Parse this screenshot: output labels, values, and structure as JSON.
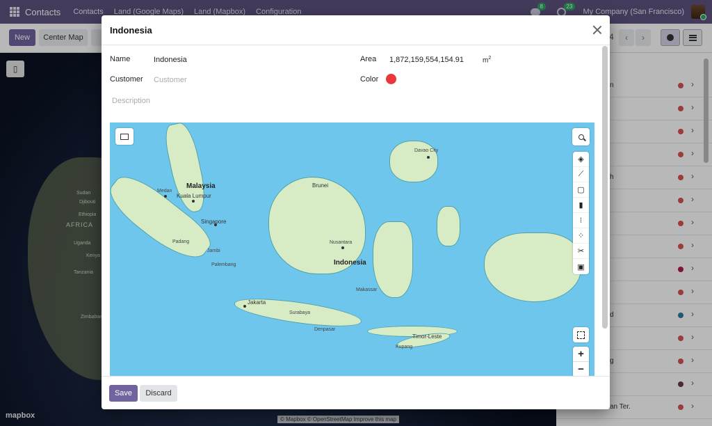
{
  "navbar": {
    "brand": "Contacts",
    "menu": [
      "Contacts",
      "Land (Google Maps)",
      "Land (Mapbox)",
      "Configuration"
    ],
    "messages_count": "8",
    "activities_count": "23",
    "company": "My Company (San Francisco)"
  },
  "control_panel": {
    "new_label": "New",
    "center_map_label": "Center Map",
    "pager": "4",
    "prev": "‹",
    "next": "›"
  },
  "background_map": {
    "labels": [
      "Sudan",
      "Djibouti",
      "Ethiopia",
      "AFRICA",
      "Uganda",
      "Kenya",
      "Tanzania",
      "Zimbabwe"
    ],
    "logo": "mapbox",
    "attribution": "© Mapbox © OpenStreetMap  Improve this map"
  },
  "list": {
    "rows": [
      {
        "text": "n",
        "color": "#d9534f"
      },
      {
        "text": "",
        "color": "#d9534f"
      },
      {
        "text": "",
        "color": "#d9534f"
      },
      {
        "text": "",
        "color": "#d9534f"
      },
      {
        "text": "h",
        "color": "#d9534f"
      },
      {
        "text": "",
        "color": "#d9534f"
      },
      {
        "text": "",
        "color": "#d9534f"
      },
      {
        "text": "",
        "color": "#d9534f"
      },
      {
        "text": "",
        "color": "#b01e4a"
      },
      {
        "text": "",
        "color": "#d9534f"
      },
      {
        "text": "d",
        "color": "#2a7ea0"
      },
      {
        "text": "",
        "color": "#d9534f"
      },
      {
        "text": "g",
        "color": "#d9534f"
      },
      {
        "text": "",
        "color": "#6b3a4e"
      },
      {
        "text": "an Ter.",
        "color": "#d9534f"
      }
    ],
    "chevron": "›"
  },
  "modal": {
    "title": "Indonesia",
    "name_label": "Name",
    "name_value": "Indonesia",
    "customer_label": "Customer",
    "customer_placeholder": "Customer",
    "description_placeholder": "Description",
    "area_label": "Area",
    "area_value": "1,872,159,554,154.91",
    "area_unit": "m",
    "area_unit_exp": "2",
    "color_label": "Color",
    "color_value": "#e8383d",
    "save_label": "Save",
    "discard_label": "Discard"
  },
  "map": {
    "labels": {
      "malaysia": "Malaysia",
      "brunei": "Brunei",
      "indonesia": "Indonesia",
      "medan": "Medan",
      "kuala_lumpur": "Kuala Lumpur",
      "singapore": "Singapore",
      "padang": "Padang",
      "jambi": "Jambi",
      "palembang": "Palembang",
      "jakarta": "Jakarta",
      "surabaya": "Surabaya",
      "denpasar": "Denpasar",
      "nusantara": "Nusantara",
      "makassar": "Makassar",
      "davao": "Davao City",
      "timor_leste": "Timor-Leste",
      "kupang": "Kupang"
    },
    "zoom_in": "+",
    "zoom_out": "−",
    "tools": [
      "point",
      "line",
      "polygon",
      "trash",
      "combine",
      "uncombine",
      "cut",
      "save"
    ]
  }
}
